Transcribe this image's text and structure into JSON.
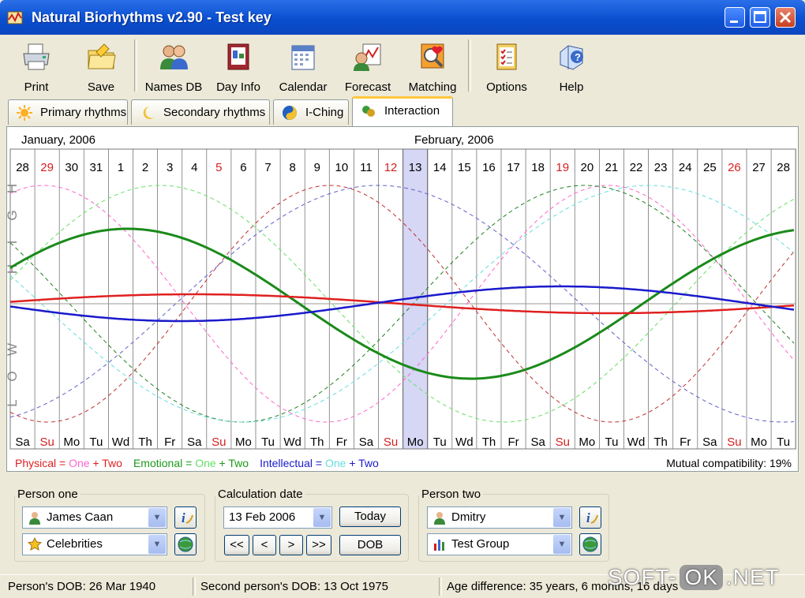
{
  "window": {
    "title": "Natural Biorhythms v2.90 - Test key"
  },
  "toolbar": {
    "items": [
      {
        "label": "Print",
        "icon": "printer-icon"
      },
      {
        "label": "Save",
        "icon": "folder-save-icon"
      },
      {
        "label": "Names DB",
        "icon": "people-icon"
      },
      {
        "label": "Day Info",
        "icon": "day-info-icon"
      },
      {
        "label": "Calendar",
        "icon": "calendar-icon"
      },
      {
        "label": "Forecast",
        "icon": "forecast-icon"
      },
      {
        "label": "Matching",
        "icon": "matching-icon"
      },
      {
        "label": "Options",
        "icon": "options-checklist-icon"
      },
      {
        "label": "Help",
        "icon": "help-icon"
      }
    ]
  },
  "tabs": [
    {
      "label": "Primary rhythms",
      "icon": "sun-icon",
      "active": false
    },
    {
      "label": "Secondary rhythms",
      "icon": "moon-icon",
      "active": false
    },
    {
      "label": "I-Ching",
      "icon": "yin-yang-icon",
      "active": false
    },
    {
      "label": "Interaction",
      "icon": "interaction-icon",
      "active": true
    }
  ],
  "chart": {
    "month_left": "January, 2006",
    "month_right": "February, 2006",
    "days": [
      "28",
      "29",
      "30",
      "31",
      "1",
      "2",
      "3",
      "4",
      "5",
      "6",
      "7",
      "8",
      "9",
      "10",
      "11",
      "12",
      "13",
      "14",
      "15",
      "16",
      "17",
      "18",
      "19",
      "20",
      "21",
      "22",
      "23",
      "24",
      "25",
      "26",
      "27",
      "28"
    ],
    "weekdays": [
      "Sa",
      "Su",
      "Mo",
      "Tu",
      "Wd",
      "Th",
      "Fr",
      "Sa",
      "Su",
      "Mo",
      "Tu",
      "Wd",
      "Th",
      "Fr",
      "Sa",
      "Su",
      "Mo",
      "Tu",
      "Wd",
      "Th",
      "Fr",
      "Sa",
      "Su",
      "Mo",
      "Tu",
      "Wd",
      "Th",
      "Fr",
      "Sa",
      "Su",
      "Mo",
      "Tu"
    ],
    "sunday_color": "#d42020",
    "highlight_index": 16,
    "high_label": "HIGH",
    "low_label": "LOW",
    "legend": [
      {
        "name": "Physical",
        "eq": " = ",
        "a": "One",
        "plus": " + ",
        "b": "Two",
        "color": "#e02020",
        "a_color": "#ff66cc",
        "b_color": "#e02020"
      },
      {
        "name": "Emotional",
        "eq": " = ",
        "a": "One",
        "plus": " + ",
        "b": "Two",
        "color": "#1a9a1a",
        "a_color": "#66e066",
        "b_color": "#1a9a1a"
      },
      {
        "name": "Intellectual",
        "eq": " = ",
        "a": "One",
        "plus": " + ",
        "b": "Two",
        "color": "#1a1acc",
        "a_color": "#66dddd",
        "b_color": "#1a1acc"
      }
    ],
    "compatibility": "Mutual compatibility: 19%",
    "colors": {
      "physical": "#e02020",
      "emotional": "#1a8a1a",
      "intellectual": "#1a1acc",
      "highlight": "#d6d6f5"
    }
  },
  "person_one": {
    "legend": "Person one",
    "name": "James Caan",
    "group": "Celebrities"
  },
  "calc_date": {
    "legend": "Calculation date",
    "date": "13 Feb 2006",
    "today_label": "Today",
    "dob_label": "DOB",
    "nav": [
      "<<",
      "<",
      ">",
      ">>"
    ]
  },
  "person_two": {
    "legend": "Person two",
    "name": "Dmitry",
    "group": "Test Group"
  },
  "status": {
    "dob1": "Person's DOB: 26 Mar 1940",
    "dob2": "Second person's DOB: 13 Oct 1975",
    "age_diff": "Age difference: 35 years, 6 months, 16 days"
  },
  "watermark": {
    "a": "SOFT-",
    "b": "OK",
    "c": ".NET"
  }
}
